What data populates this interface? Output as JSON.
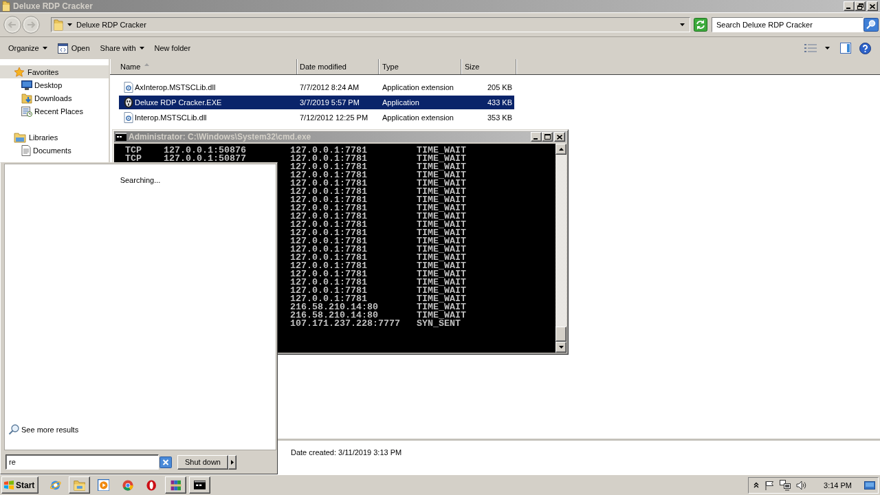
{
  "explorer": {
    "title": "Deluxe RDP Cracker",
    "address": "Deluxe RDP Cracker",
    "search": {
      "placeholder": "Search Deluxe RDP Cracker"
    },
    "toolbar": [
      {
        "label": "Organize",
        "kind": "menu"
      },
      {
        "label": "Open",
        "kind": "icon"
      },
      {
        "label": "Share with",
        "kind": "menu"
      },
      {
        "label": "New folder",
        "kind": "plain"
      }
    ],
    "sidebar": [
      {
        "label": "Favorites",
        "selected": true,
        "children": [
          {
            "label": "Desktop",
            "selected": false
          },
          {
            "label": "Downloads",
            "selected": false
          },
          {
            "label": "Recent Places",
            "selected": false
          }
        ]
      },
      {
        "label": "Libraries",
        "selected": false,
        "children": [
          {
            "label": "Documents",
            "selected": false
          }
        ]
      }
    ],
    "columns": [
      {
        "label": "Name",
        "sorted": true
      },
      {
        "label": "Date modified",
        "sorted": false
      },
      {
        "label": "Type",
        "sorted": false
      },
      {
        "label": "Size",
        "sorted": false
      }
    ],
    "files": [
      {
        "name": "AxInterop.MSTSCLib.dll",
        "date": "7/7/2012 8:24 AM",
        "type": "Application extension",
        "size": "205 KB",
        "kind": "extension",
        "selected": false
      },
      {
        "name": "Deluxe RDP Cracker.EXE",
        "date": "3/7/2019 5:57 PM",
        "type": "Application",
        "size": "433 KB",
        "kind": "application",
        "selected": true
      },
      {
        "name": "Interop.MSTSCLib.dll",
        "date": "7/12/2012 12:25 PM",
        "type": "Application extension",
        "size": "353 KB",
        "kind": "extension",
        "selected": false
      }
    ],
    "details": {
      "label": "Date created:",
      "value": "3/11/2019 3:13 PM"
    }
  },
  "console": {
    "title": "Administrator: C:\\Windows\\System32\\cmd.exe",
    "lines": [
      {
        "proto": "TCP",
        "local": "127.0.0.1:50876",
        "foreign": "127.0.0.1:7781",
        "state": "TIME_WAIT"
      },
      {
        "proto": "TCP",
        "local": "127.0.0.1:50877",
        "foreign": "127.0.0.1:7781",
        "state": "TIME_WAIT"
      },
      {
        "foreign": "127.0.0.1:7781",
        "state": "TIME_WAIT"
      },
      {
        "foreign": "127.0.0.1:7781",
        "state": "TIME_WAIT"
      },
      {
        "foreign": "127.0.0.1:7781",
        "state": "TIME_WAIT"
      },
      {
        "foreign": "127.0.0.1:7781",
        "state": "TIME_WAIT"
      },
      {
        "foreign": "127.0.0.1:7781",
        "state": "TIME_WAIT"
      },
      {
        "foreign": "127.0.0.1:7781",
        "state": "TIME_WAIT"
      },
      {
        "foreign": "127.0.0.1:7781",
        "state": "TIME_WAIT"
      },
      {
        "foreign": "127.0.0.1:7781",
        "state": "TIME_WAIT"
      },
      {
        "foreign": "127.0.0.1:7781",
        "state": "TIME_WAIT"
      },
      {
        "foreign": "127.0.0.1:7781",
        "state": "TIME_WAIT"
      },
      {
        "foreign": "127.0.0.1:7781",
        "state": "TIME_WAIT"
      },
      {
        "foreign": "127.0.0.1:7781",
        "state": "TIME_WAIT"
      },
      {
        "foreign": "127.0.0.1:7781",
        "state": "TIME_WAIT"
      },
      {
        "foreign": "127.0.0.1:7781",
        "state": "TIME_WAIT"
      },
      {
        "foreign": "127.0.0.1:7781",
        "state": "TIME_WAIT"
      },
      {
        "foreign": "127.0.0.1:7781",
        "state": "TIME_WAIT"
      },
      {
        "foreign": "127.0.0.1:7781",
        "state": "TIME_WAIT"
      },
      {
        "foreign": "216.58.210.14:80",
        "state": "TIME_WAIT"
      },
      {
        "foreign": "216.58.210.14:80",
        "state": "TIME_WAIT"
      },
      {
        "foreign": "107.171.237.228:7777",
        "state": "SYN_SENT"
      }
    ]
  },
  "start_menu": {
    "status": "Searching...",
    "more_results": "See more results",
    "search": {
      "value": "re"
    },
    "shutdown": "Shut down"
  },
  "taskbar": {
    "start": "Start",
    "apps": [
      {
        "running": false
      },
      {
        "running": true
      },
      {
        "running": false
      },
      {
        "running": false
      },
      {
        "running": false
      },
      {
        "running": true
      },
      {
        "running": true
      }
    ],
    "clock": "3:14 PM"
  }
}
